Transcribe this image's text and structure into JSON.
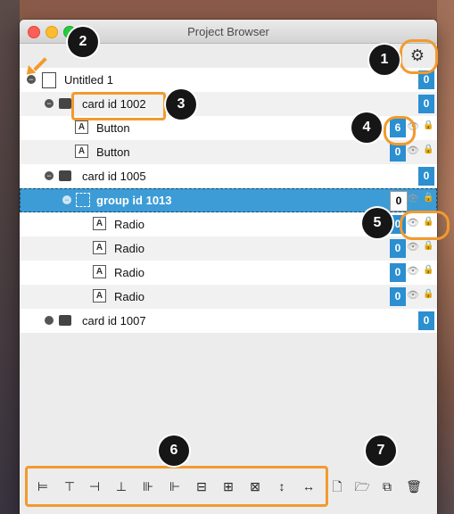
{
  "window": {
    "title": "Project Browser"
  },
  "rows": [
    {
      "label": "Untitled 1",
      "count": "0"
    },
    {
      "label": "card id 1002",
      "count": "0"
    },
    {
      "label": "Button",
      "count": "6"
    },
    {
      "label": "Button",
      "count": "0"
    },
    {
      "label": "card id 1005",
      "count": "0"
    },
    {
      "label": "group id 1013",
      "count": "0"
    },
    {
      "label": "Radio",
      "count": "0"
    },
    {
      "label": "Radio",
      "count": "0"
    },
    {
      "label": "Radio",
      "count": "0"
    },
    {
      "label": "Radio",
      "count": "0"
    },
    {
      "label": "card id 1007",
      "count": "0"
    }
  ],
  "callouts": [
    "1",
    "2",
    "3",
    "4",
    "5",
    "6",
    "7"
  ],
  "icons": {
    "gear": "⚙",
    "button": "A",
    "eye": "👁",
    "lock": "🔒",
    "minus": "−",
    "tools": [
      "⊨",
      "⊤",
      "⊣",
      "⊥",
      "⊪",
      "⊩",
      "⊟",
      "⊞",
      "⊠",
      "↕",
      "↔"
    ],
    "actions": [
      "🗋",
      "🗁",
      "⧉",
      "🗑"
    ]
  },
  "colors": {
    "accent": "#f29a2e",
    "selection": "#3d9cd5",
    "badge": "#2b8fd0"
  }
}
